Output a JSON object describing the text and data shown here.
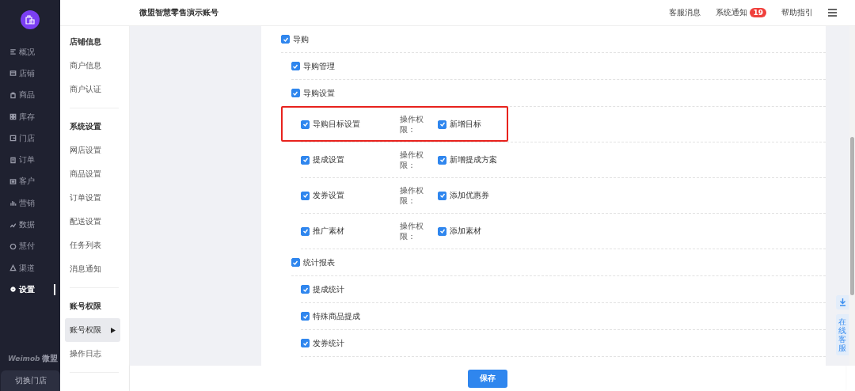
{
  "topbar": {
    "title": "微盟智慧零售演示账号",
    "links": [
      {
        "label": "客服消息"
      },
      {
        "label": "系统通知",
        "badge": "19"
      },
      {
        "label": "帮助指引"
      }
    ]
  },
  "nav": {
    "items": [
      {
        "label": "概况",
        "selected": false
      },
      {
        "label": "店铺",
        "selected": false
      },
      {
        "label": "商品",
        "selected": false
      },
      {
        "label": "库存",
        "selected": false
      },
      {
        "label": "门店",
        "selected": false
      },
      {
        "label": "订单",
        "selected": false
      },
      {
        "label": "客户",
        "selected": false
      },
      {
        "label": "营销",
        "selected": false
      },
      {
        "label": "数据",
        "selected": false
      },
      {
        "label": "慧付",
        "selected": false
      },
      {
        "label": "渠道",
        "selected": false
      },
      {
        "label": "设置",
        "selected": true
      }
    ],
    "brand": "Weimob",
    "brand_sub": "微盟",
    "switch_button": "切换门店"
  },
  "submenu": [
    {
      "heading": "店铺信息",
      "items": [
        {
          "label": "商户信息",
          "selected": false
        },
        {
          "label": "商户认证",
          "selected": false
        }
      ]
    },
    {
      "heading": "系统设置",
      "items": [
        {
          "label": "网店设置",
          "selected": false
        },
        {
          "label": "商品设置",
          "selected": false
        },
        {
          "label": "订单设置",
          "selected": false
        },
        {
          "label": "配送设置",
          "selected": false
        },
        {
          "label": "任务列表",
          "selected": false
        },
        {
          "label": "消息通知",
          "selected": false
        }
      ]
    },
    {
      "heading": "账号权限",
      "items": [
        {
          "label": "账号权限",
          "selected": true
        },
        {
          "label": "操作日志",
          "selected": false
        }
      ]
    }
  ],
  "permissions": [
    {
      "label": "导购",
      "checked": true,
      "children": [
        {
          "label": "导购管理",
          "checked": true
        },
        {
          "label": "导购设置",
          "checked": true,
          "children": [
            {
              "label": "导购目标设置",
              "checked": true,
              "highlighted": true,
              "ops_label": "操作权限：",
              "ops": [
                {
                  "label": "新增目标",
                  "checked": true
                }
              ]
            },
            {
              "label": "提成设置",
              "checked": true,
              "ops_label": "操作权限：",
              "ops": [
                {
                  "label": "新增提成方案",
                  "checked": true
                }
              ]
            },
            {
              "label": "发券设置",
              "checked": true,
              "ops_label": "操作权限：",
              "ops": [
                {
                  "label": "添加优惠券",
                  "checked": true
                }
              ]
            },
            {
              "label": "推广素材",
              "checked": true,
              "ops_label": "操作权限：",
              "ops": [
                {
                  "label": "添加素材",
                  "checked": true
                }
              ]
            }
          ]
        },
        {
          "label": "统计报表",
          "checked": true,
          "children": [
            {
              "label": "提成统计",
              "checked": true
            },
            {
              "label": "特殊商品提成",
              "checked": true
            },
            {
              "label": "发券统计",
              "checked": true
            }
          ]
        }
      ]
    }
  ],
  "side_tools": {
    "service_tab": "在线客服"
  },
  "save_button": "保存"
}
